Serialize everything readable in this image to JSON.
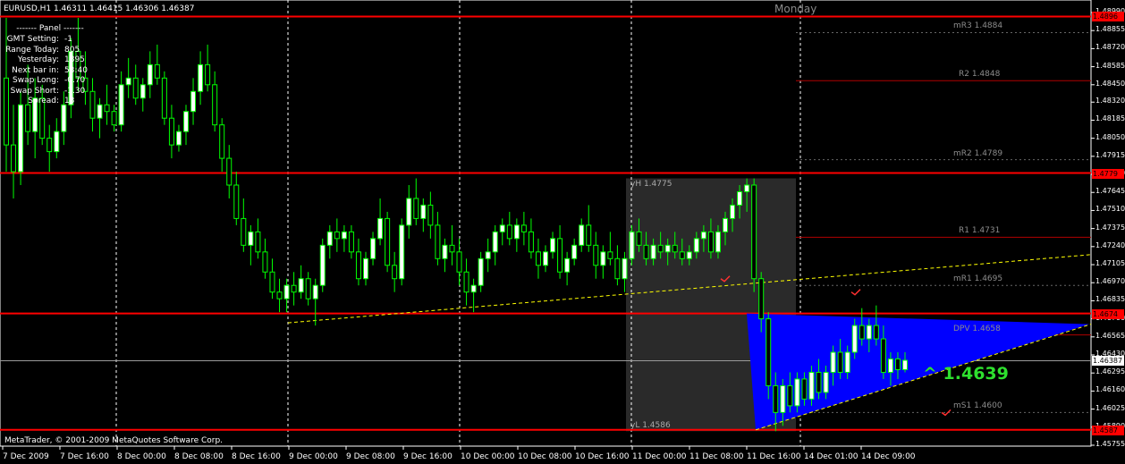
{
  "header": {
    "symbol_line": "EURUSD,H1  1.46311 1.46415 1.46306 1.46387",
    "day_label": "Monday"
  },
  "panel": {
    "title": "Panel",
    "rows": [
      {
        "label": "GMT Setting:",
        "value": "-1"
      },
      {
        "label": "Range Today:",
        "value": "805"
      },
      {
        "label": "Yesterday:",
        "value": "1895"
      },
      {
        "label": "Next bar in:",
        "value": "53:40"
      },
      {
        "label": "Swap Long:",
        "value": "-0.70"
      },
      {
        "label": "Swap Short:",
        "value": "-1.30"
      },
      {
        "label": "Spread:",
        "value": "13"
      }
    ]
  },
  "footer": {
    "copyright": "MetaTrader, © 2001-2009 MetaQuotes Software Corp."
  },
  "bid_label": "^ 1.4639",
  "levels": [
    {
      "label": "mR3 1.4884",
      "price": 1.4884
    },
    {
      "label": "R2 1.4848",
      "price": 1.4848
    },
    {
      "label": "mR2 1.4789",
      "price": 1.4789
    },
    {
      "label": "R1 1.4731",
      "price": 1.4731
    },
    {
      "label": "mR1 1.4695",
      "price": 1.4695
    },
    {
      "label": "DPV 1.4658",
      "price": 1.4658
    },
    {
      "label": "mS1 1.4600",
      "price": 1.46
    }
  ],
  "yesterday": {
    "high_label": "yH 1.4775",
    "low_label": "yL 1.4586"
  },
  "price_boxes": [
    {
      "text": "1.4896",
      "price": 1.4896,
      "color": "red"
    },
    {
      "text": "1.4779",
      "price": 1.4779,
      "color": "red"
    },
    {
      "text": "1.4674",
      "price": 1.4674,
      "color": "red"
    },
    {
      "text": "1.46387",
      "price": 1.46387,
      "color": "white"
    },
    {
      "text": "1.4587",
      "price": 1.4587,
      "color": "red"
    }
  ],
  "price_ticks": [
    "1.48990",
    "1.48855",
    "1.48720",
    "1.48585",
    "1.48450",
    "1.48320",
    "1.48185",
    "1.48050",
    "1.47915",
    "1.47780",
    "1.47645",
    "1.47510",
    "1.47375",
    "1.47240",
    "1.47105",
    "1.46970",
    "1.46835",
    "1.46700",
    "1.46565",
    "1.46430",
    "1.46295",
    "1.46160",
    "1.46025",
    "1.45890",
    "1.45755"
  ],
  "time_ticks": [
    "7 Dec 2009",
    "7 Dec 16:00",
    "8 Dec 00:00",
    "8 Dec 08:00",
    "8 Dec 16:00",
    "9 Dec 00:00",
    "9 Dec 08:00",
    "9 Dec 16:00",
    "10 Dec 00:00",
    "10 Dec 08:00",
    "10 Dec 16:00",
    "11 Dec 00:00",
    "11 Dec 08:00",
    "11 Dec 16:00",
    "14 Dec 01:00",
    "14 Dec 09:00"
  ],
  "colors": {
    "background": "#000000",
    "bull": "#ffffff",
    "bear": "#000000",
    "wick": "#00ff00",
    "resistance": "#ff0000",
    "trendline": "#ffff00",
    "triangle": "#0000ff",
    "bid": "#2ee02e"
  },
  "chart_data": {
    "type": "candlestick",
    "symbol": "EURUSD",
    "timeframe": "H1",
    "bars": [
      [
        1.485,
        1.4895,
        1.478,
        1.48
      ],
      [
        1.48,
        1.483,
        1.476,
        1.478
      ],
      [
        1.478,
        1.484,
        1.477,
        1.483
      ],
      [
        1.483,
        1.486,
        1.48,
        1.481
      ],
      [
        1.481,
        1.485,
        1.479,
        1.4835
      ],
      [
        1.4835,
        1.4845,
        1.48,
        1.4805
      ],
      [
        1.4805,
        1.4815,
        1.478,
        1.4795
      ],
      [
        1.4795,
        1.482,
        1.479,
        1.481
      ],
      [
        1.481,
        1.484,
        1.48,
        1.483
      ],
      [
        1.483,
        1.488,
        1.482,
        1.487
      ],
      [
        1.487,
        1.4895,
        1.484,
        1.485
      ],
      [
        1.485,
        1.487,
        1.483,
        1.484
      ],
      [
        1.484,
        1.485,
        1.481,
        1.482
      ],
      [
        1.482,
        1.4835,
        1.4805,
        1.483
      ],
      [
        1.483,
        1.4845,
        1.4815,
        1.4825
      ],
      [
        1.4825,
        1.483,
        1.481,
        1.4815
      ],
      [
        1.4815,
        1.4855,
        1.481,
        1.4845
      ],
      [
        1.4845,
        1.4865,
        1.4835,
        1.485
      ],
      [
        1.485,
        1.486,
        1.483,
        1.4835
      ],
      [
        1.4835,
        1.485,
        1.4825,
        1.4845
      ],
      [
        1.4845,
        1.487,
        1.4835,
        1.486
      ],
      [
        1.486,
        1.4875,
        1.4845,
        1.485
      ],
      [
        1.485,
        1.4855,
        1.4815,
        1.482
      ],
      [
        1.482,
        1.483,
        1.479,
        1.48
      ],
      [
        1.48,
        1.4815,
        1.4795,
        1.481
      ],
      [
        1.481,
        1.483,
        1.48,
        1.4825
      ],
      [
        1.4825,
        1.485,
        1.4815,
        1.484
      ],
      [
        1.484,
        1.487,
        1.483,
        1.486
      ],
      [
        1.486,
        1.4875,
        1.484,
        1.4845
      ],
      [
        1.4845,
        1.4855,
        1.481,
        1.4815
      ],
      [
        1.4815,
        1.482,
        1.478,
        1.479
      ],
      [
        1.479,
        1.48,
        1.476,
        1.477
      ],
      [
        1.477,
        1.478,
        1.474,
        1.4745
      ],
      [
        1.4745,
        1.476,
        1.472,
        1.4725
      ],
      [
        1.4725,
        1.474,
        1.471,
        1.4735
      ],
      [
        1.4735,
        1.4745,
        1.4715,
        1.472
      ],
      [
        1.472,
        1.473,
        1.47,
        1.4705
      ],
      [
        1.4705,
        1.4715,
        1.4685,
        1.469
      ],
      [
        1.469,
        1.47,
        1.4675,
        1.4685
      ],
      [
        1.4685,
        1.47,
        1.4675,
        1.4695
      ],
      [
        1.4695,
        1.4705,
        1.468,
        1.469
      ],
      [
        1.469,
        1.471,
        1.4685,
        1.47
      ],
      [
        1.47,
        1.4705,
        1.468,
        1.4685
      ],
      [
        1.4685,
        1.47,
        1.4665,
        1.4695
      ],
      [
        1.4695,
        1.473,
        1.469,
        1.4725
      ],
      [
        1.4725,
        1.474,
        1.4715,
        1.4735
      ],
      [
        1.4735,
        1.4745,
        1.472,
        1.473
      ],
      [
        1.473,
        1.474,
        1.472,
        1.4735
      ],
      [
        1.4735,
        1.474,
        1.4715,
        1.472
      ],
      [
        1.472,
        1.473,
        1.4695,
        1.47
      ],
      [
        1.47,
        1.472,
        1.4695,
        1.4715
      ],
      [
        1.4715,
        1.4735,
        1.471,
        1.473
      ],
      [
        1.473,
        1.476,
        1.4725,
        1.4745
      ],
      [
        1.4745,
        1.475,
        1.4705,
        1.471
      ],
      [
        1.471,
        1.472,
        1.469,
        1.47
      ],
      [
        1.47,
        1.4745,
        1.4695,
        1.474
      ],
      [
        1.474,
        1.477,
        1.473,
        1.476
      ],
      [
        1.476,
        1.4775,
        1.474,
        1.4745
      ],
      [
        1.4745,
        1.476,
        1.4735,
        1.4755
      ],
      [
        1.4755,
        1.4765,
        1.473,
        1.474
      ],
      [
        1.474,
        1.475,
        1.471,
        1.4715
      ],
      [
        1.4715,
        1.473,
        1.4705,
        1.4725
      ],
      [
        1.4725,
        1.474,
        1.471,
        1.472
      ],
      [
        1.472,
        1.473,
        1.4695,
        1.4705
      ],
      [
        1.4705,
        1.4715,
        1.468,
        1.469
      ],
      [
        1.469,
        1.47,
        1.4675,
        1.4695
      ],
      [
        1.4695,
        1.472,
        1.469,
        1.4715
      ],
      [
        1.4715,
        1.473,
        1.4705,
        1.472
      ],
      [
        1.472,
        1.474,
        1.471,
        1.4735
      ],
      [
        1.4735,
        1.4745,
        1.4725,
        1.474
      ],
      [
        1.474,
        1.475,
        1.4725,
        1.473
      ],
      [
        1.473,
        1.4745,
        1.472,
        1.474
      ],
      [
        1.474,
        1.475,
        1.4725,
        1.4735
      ],
      [
        1.4735,
        1.4745,
        1.4715,
        1.472
      ],
      [
        1.472,
        1.473,
        1.47,
        1.471
      ],
      [
        1.471,
        1.4725,
        1.4705,
        1.472
      ],
      [
        1.472,
        1.4735,
        1.4715,
        1.473
      ],
      [
        1.473,
        1.474,
        1.47,
        1.4705
      ],
      [
        1.4705,
        1.472,
        1.4695,
        1.4715
      ],
      [
        1.4715,
        1.473,
        1.471,
        1.4725
      ],
      [
        1.4725,
        1.4745,
        1.472,
        1.474
      ],
      [
        1.474,
        1.4755,
        1.472,
        1.4725
      ],
      [
        1.4725,
        1.4735,
        1.47,
        1.471
      ],
      [
        1.471,
        1.4725,
        1.47,
        1.472
      ],
      [
        1.472,
        1.4735,
        1.471,
        1.4715
      ],
      [
        1.4715,
        1.4725,
        1.4695,
        1.47
      ],
      [
        1.47,
        1.472,
        1.469,
        1.4715
      ],
      [
        1.4715,
        1.474,
        1.471,
        1.4735
      ],
      [
        1.4735,
        1.4745,
        1.472,
        1.4725
      ],
      [
        1.4725,
        1.4735,
        1.471,
        1.4715
      ],
      [
        1.4715,
        1.473,
        1.471,
        1.4725
      ],
      [
        1.4725,
        1.4735,
        1.4715,
        1.472
      ],
      [
        1.472,
        1.473,
        1.471,
        1.4725
      ],
      [
        1.4725,
        1.4735,
        1.4715,
        1.472
      ],
      [
        1.472,
        1.473,
        1.471,
        1.4715
      ],
      [
        1.4715,
        1.4725,
        1.471,
        1.472
      ],
      [
        1.472,
        1.4735,
        1.4715,
        1.473
      ],
      [
        1.473,
        1.474,
        1.472,
        1.4735
      ],
      [
        1.4735,
        1.4745,
        1.4715,
        1.472
      ],
      [
        1.472,
        1.474,
        1.4715,
        1.4735
      ],
      [
        1.4735,
        1.475,
        1.4725,
        1.4745
      ],
      [
        1.4745,
        1.476,
        1.4735,
        1.4755
      ],
      [
        1.4755,
        1.477,
        1.4745,
        1.4765
      ],
      [
        1.4765,
        1.4775,
        1.475,
        1.477
      ],
      [
        1.477,
        1.4775,
        1.469,
        1.47
      ],
      [
        1.47,
        1.4705,
        1.466,
        1.467
      ],
      [
        1.467,
        1.4675,
        1.461,
        1.462
      ],
      [
        1.462,
        1.463,
        1.4586,
        1.46
      ],
      [
        1.46,
        1.4625,
        1.459,
        1.462
      ],
      [
        1.462,
        1.463,
        1.46,
        1.4605
      ],
      [
        1.4605,
        1.463,
        1.46,
        1.4625
      ],
      [
        1.4625,
        1.463,
        1.4605,
        1.461
      ],
      [
        1.461,
        1.4635,
        1.4605,
        1.463
      ],
      [
        1.463,
        1.464,
        1.461,
        1.4615
      ],
      [
        1.4615,
        1.4635,
        1.461,
        1.463
      ],
      [
        1.463,
        1.465,
        1.462,
        1.4645
      ],
      [
        1.4645,
        1.4655,
        1.4625,
        1.463
      ],
      [
        1.463,
        1.465,
        1.4625,
        1.4645
      ],
      [
        1.4645,
        1.467,
        1.464,
        1.4665
      ],
      [
        1.4665,
        1.4678,
        1.465,
        1.4655
      ],
      [
        1.4655,
        1.467,
        1.4645,
        1.4665
      ],
      [
        1.4665,
        1.468,
        1.465,
        1.4655
      ],
      [
        1.4655,
        1.4665,
        1.4625,
        1.463
      ],
      [
        1.463,
        1.4645,
        1.462,
        1.464
      ],
      [
        1.464,
        1.4645,
        1.4625,
        1.4632
      ],
      [
        1.4632,
        1.4645,
        1.463,
        1.4639
      ]
    ]
  }
}
